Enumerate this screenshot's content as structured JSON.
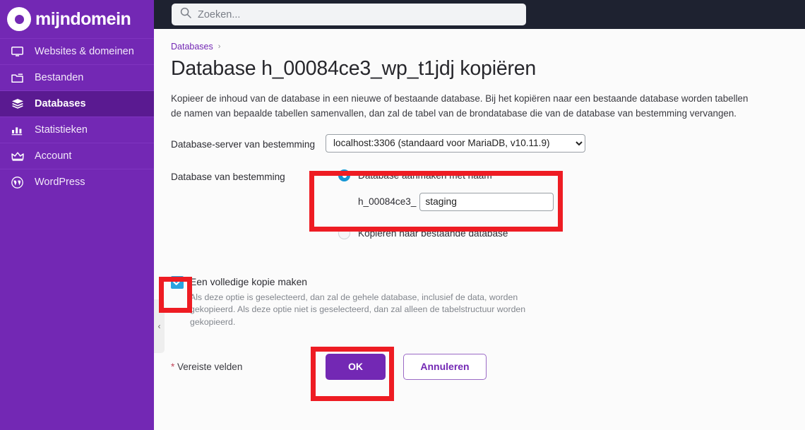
{
  "brand": {
    "name": "mijndomein",
    "sidebar_color": "#7328b4",
    "active_color": "#5a1a91",
    "topbar_color": "#1e2230",
    "accent_color": "#7328b4",
    "highlight_color": "#ee1c23",
    "control_blue": "#1496d4"
  },
  "sidebar": {
    "items": [
      {
        "label": "Websites & domeinen",
        "icon": "monitor-icon",
        "active": false
      },
      {
        "label": "Bestanden",
        "icon": "folder-icon",
        "active": false
      },
      {
        "label": "Databases",
        "icon": "layers-icon",
        "active": true
      },
      {
        "label": "Statistieken",
        "icon": "bar-chart-icon",
        "active": false
      },
      {
        "label": "Account",
        "icon": "crown-icon",
        "active": false
      },
      {
        "label": "WordPress",
        "icon": "wordpress-icon",
        "active": false
      }
    ]
  },
  "topbar": {
    "search": {
      "value": "",
      "placeholder": "Zoeken...",
      "icon": "search-icon"
    }
  },
  "breadcrumb": {
    "items": [
      "Databases"
    ],
    "separator": "›"
  },
  "page": {
    "title": "Database h_00084ce3_wp_t1jdj kopiëren",
    "intro_line1": "Kopieer de inhoud van de database in een nieuwe of bestaande database. Bij het kopiëren naar een bestaande database worden tabellen",
    "intro_line2": "de namen van bepaalde tabellen samenvallen, dan zal de tabel van de brondatabase die van de database van bestemming vervangen."
  },
  "form": {
    "server_row": {
      "label": "Database-server van bestemming",
      "selected": "localhost:3306 (standaard voor MariaDB, v10.11.9)",
      "options": [
        "localhost:3306 (standaard voor MariaDB, v10.11.9)"
      ]
    },
    "destination_row": {
      "label": "Database van bestemming",
      "option_create": {
        "label": "Database aanmaken met naam",
        "selected": true
      },
      "name_prefix": "h_00084ce3_",
      "name_value": "staging",
      "option_existing": {
        "label": "Kopiëren naar bestaande database",
        "selected": false
      }
    },
    "full_copy": {
      "label": "Een volledige kopie maken",
      "checked": true,
      "help": "Als deze optie is geselecteerd, dan zal de gehele database, inclusief de data, worden gekopieerd. Als deze optie niet is geselecteerd, dan zal alleen de tabelstructuur worden gekopieerd."
    }
  },
  "footer": {
    "required_star": "*",
    "required_text": " Vereiste velden",
    "ok_label": "OK",
    "cancel_label": "Annuleren"
  },
  "collapse": {
    "chevron": "‹"
  }
}
